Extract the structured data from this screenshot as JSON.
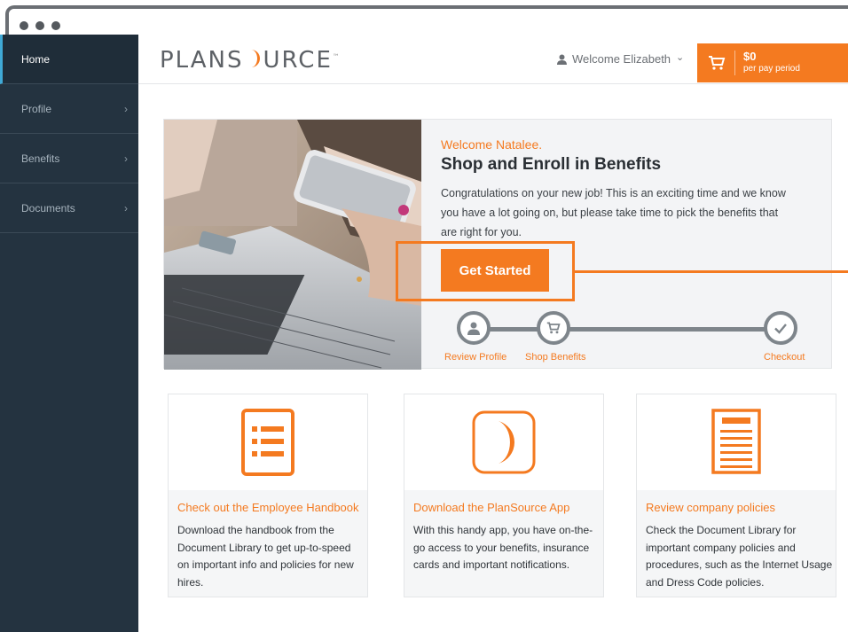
{
  "sidebar": {
    "items": [
      {
        "label": "Home",
        "active": true
      },
      {
        "label": "Profile",
        "chevron": "›"
      },
      {
        "label": "Benefits",
        "chevron": "›"
      },
      {
        "label": "Documents",
        "chevron": "›"
      }
    ]
  },
  "header": {
    "logo_text_a": "PLANS",
    "logo_text_b": "URCE",
    "welcome": "Welcome Elizabeth",
    "welcome_caret": "⌄",
    "cart_amount": "$0",
    "cart_period": "per pay period"
  },
  "hero": {
    "greeting": "Welcome Natalee.",
    "title": "Shop and Enroll in Benefits",
    "text": "Congratulations on your new job! This is an exciting time and we know you have a lot going on, but please take time to pick the benefits that are right for you.",
    "button": "Get Started",
    "steps": [
      {
        "label": "Review Profile",
        "icon": "user-icon"
      },
      {
        "label": "Shop Benefits",
        "icon": "cart-icon"
      },
      {
        "label": "Checkout",
        "icon": "check-icon"
      }
    ]
  },
  "cards": [
    {
      "title": "Check out the Employee Handbook",
      "text": "Download the handbook from the Document Library to get up-to-speed on important info and policies for new hires.",
      "icon": "list-document-icon"
    },
    {
      "title": "Download the PlanSource App",
      "text": "With this handy app, you have on-the-go access to your benefits, insurance cards and important notifications.",
      "icon": "app-logo-icon"
    },
    {
      "title": "Review company policies",
      "text": "Check the Document Library for important company policies and procedures, such as the Internet Usage and Dress Code policies.",
      "icon": "policy-document-icon"
    }
  ],
  "colors": {
    "accent": "#f47a20",
    "sidebar": "#243340",
    "step_gray": "#7e858b"
  }
}
